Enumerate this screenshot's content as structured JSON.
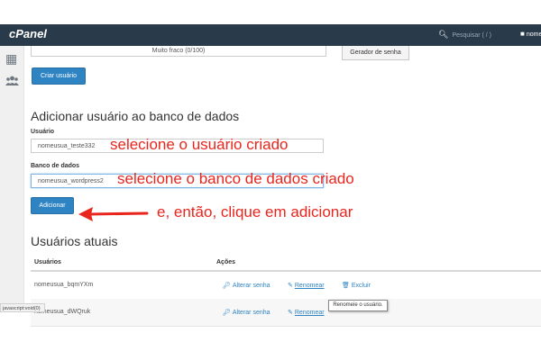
{
  "header": {
    "logo": "cPanel",
    "search_placeholder": "Pesquisar ( / )",
    "search_icon": "magnifier-icon",
    "user_name": "nome",
    "user_icon": "person-icon",
    "background": "#293a4a"
  },
  "sidebar": {
    "items": [
      {
        "icon": "grid-icon",
        "glyph": "▦"
      },
      {
        "icon": "users-icon",
        "glyph": "👥"
      }
    ]
  },
  "create_user": {
    "strength_text": "Muito fraco (0/100)",
    "generator_label": "Gerador de senha",
    "create_button": "Criar usuário"
  },
  "add_user": {
    "title": "Adicionar usuário ao banco de dados",
    "user_label": "Usuário",
    "user_value": "nomeusua_teste332",
    "db_label": "Banco de dados",
    "db_value": "nomeusua_wordpress2",
    "add_button": "Adicionar"
  },
  "current_users": {
    "title": "Usuários atuais",
    "columns": [
      "Usuários",
      "Ações"
    ],
    "rows": [
      {
        "user": "nomeusua_bqmYXm",
        "change_password": "Alterar senha",
        "rename": "Renomear",
        "delete": "Excluir"
      },
      {
        "user": "nomeusua_dWQruk",
        "change_password": "Alterar senha",
        "rename": "Renomear"
      }
    ]
  },
  "tooltip": "Renomeie o usuário.",
  "statusbar": "javascript:void(0)",
  "annotations": {
    "select_user": "selecione o usuário criado",
    "select_db": "selecione o banco de dados criado",
    "click_add": "e, então, clique em adicionar",
    "color": "#e8261e"
  },
  "colors": {
    "primary_button": "#2e84c2",
    "link": "#2e84c2"
  }
}
